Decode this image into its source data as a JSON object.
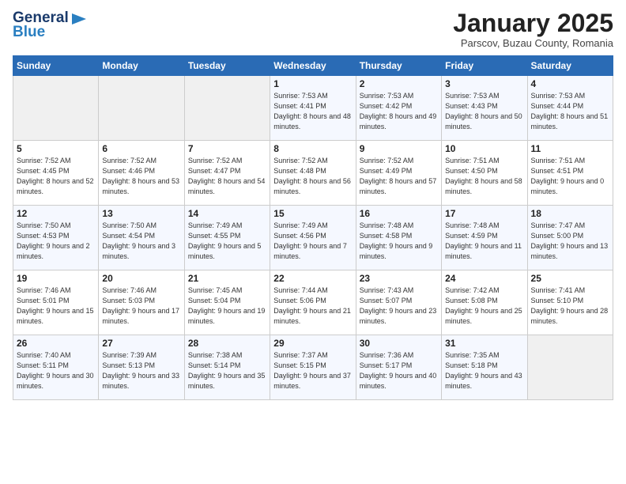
{
  "logo": {
    "line1": "General",
    "line2": "Blue",
    "flag_unicode": "🔵"
  },
  "title": "January 2025",
  "subtitle": "Parscov, Buzau County, Romania",
  "header_days": [
    "Sunday",
    "Monday",
    "Tuesday",
    "Wednesday",
    "Thursday",
    "Friday",
    "Saturday"
  ],
  "weeks": [
    [
      {
        "day": "",
        "sunrise": "",
        "sunset": "",
        "daylight": ""
      },
      {
        "day": "",
        "sunrise": "",
        "sunset": "",
        "daylight": ""
      },
      {
        "day": "",
        "sunrise": "",
        "sunset": "",
        "daylight": ""
      },
      {
        "day": "1",
        "sunrise": "Sunrise: 7:53 AM",
        "sunset": "Sunset: 4:41 PM",
        "daylight": "Daylight: 8 hours and 48 minutes."
      },
      {
        "day": "2",
        "sunrise": "Sunrise: 7:53 AM",
        "sunset": "Sunset: 4:42 PM",
        "daylight": "Daylight: 8 hours and 49 minutes."
      },
      {
        "day": "3",
        "sunrise": "Sunrise: 7:53 AM",
        "sunset": "Sunset: 4:43 PM",
        "daylight": "Daylight: 8 hours and 50 minutes."
      },
      {
        "day": "4",
        "sunrise": "Sunrise: 7:53 AM",
        "sunset": "Sunset: 4:44 PM",
        "daylight": "Daylight: 8 hours and 51 minutes."
      }
    ],
    [
      {
        "day": "5",
        "sunrise": "Sunrise: 7:52 AM",
        "sunset": "Sunset: 4:45 PM",
        "daylight": "Daylight: 8 hours and 52 minutes."
      },
      {
        "day": "6",
        "sunrise": "Sunrise: 7:52 AM",
        "sunset": "Sunset: 4:46 PM",
        "daylight": "Daylight: 8 hours and 53 minutes."
      },
      {
        "day": "7",
        "sunrise": "Sunrise: 7:52 AM",
        "sunset": "Sunset: 4:47 PM",
        "daylight": "Daylight: 8 hours and 54 minutes."
      },
      {
        "day": "8",
        "sunrise": "Sunrise: 7:52 AM",
        "sunset": "Sunset: 4:48 PM",
        "daylight": "Daylight: 8 hours and 56 minutes."
      },
      {
        "day": "9",
        "sunrise": "Sunrise: 7:52 AM",
        "sunset": "Sunset: 4:49 PM",
        "daylight": "Daylight: 8 hours and 57 minutes."
      },
      {
        "day": "10",
        "sunrise": "Sunrise: 7:51 AM",
        "sunset": "Sunset: 4:50 PM",
        "daylight": "Daylight: 8 hours and 58 minutes."
      },
      {
        "day": "11",
        "sunrise": "Sunrise: 7:51 AM",
        "sunset": "Sunset: 4:51 PM",
        "daylight": "Daylight: 9 hours and 0 minutes."
      }
    ],
    [
      {
        "day": "12",
        "sunrise": "Sunrise: 7:50 AM",
        "sunset": "Sunset: 4:53 PM",
        "daylight": "Daylight: 9 hours and 2 minutes."
      },
      {
        "day": "13",
        "sunrise": "Sunrise: 7:50 AM",
        "sunset": "Sunset: 4:54 PM",
        "daylight": "Daylight: 9 hours and 3 minutes."
      },
      {
        "day": "14",
        "sunrise": "Sunrise: 7:49 AM",
        "sunset": "Sunset: 4:55 PM",
        "daylight": "Daylight: 9 hours and 5 minutes."
      },
      {
        "day": "15",
        "sunrise": "Sunrise: 7:49 AM",
        "sunset": "Sunset: 4:56 PM",
        "daylight": "Daylight: 9 hours and 7 minutes."
      },
      {
        "day": "16",
        "sunrise": "Sunrise: 7:48 AM",
        "sunset": "Sunset: 4:58 PM",
        "daylight": "Daylight: 9 hours and 9 minutes."
      },
      {
        "day": "17",
        "sunrise": "Sunrise: 7:48 AM",
        "sunset": "Sunset: 4:59 PM",
        "daylight": "Daylight: 9 hours and 11 minutes."
      },
      {
        "day": "18",
        "sunrise": "Sunrise: 7:47 AM",
        "sunset": "Sunset: 5:00 PM",
        "daylight": "Daylight: 9 hours and 13 minutes."
      }
    ],
    [
      {
        "day": "19",
        "sunrise": "Sunrise: 7:46 AM",
        "sunset": "Sunset: 5:01 PM",
        "daylight": "Daylight: 9 hours and 15 minutes."
      },
      {
        "day": "20",
        "sunrise": "Sunrise: 7:46 AM",
        "sunset": "Sunset: 5:03 PM",
        "daylight": "Daylight: 9 hours and 17 minutes."
      },
      {
        "day": "21",
        "sunrise": "Sunrise: 7:45 AM",
        "sunset": "Sunset: 5:04 PM",
        "daylight": "Daylight: 9 hours and 19 minutes."
      },
      {
        "day": "22",
        "sunrise": "Sunrise: 7:44 AM",
        "sunset": "Sunset: 5:06 PM",
        "daylight": "Daylight: 9 hours and 21 minutes."
      },
      {
        "day": "23",
        "sunrise": "Sunrise: 7:43 AM",
        "sunset": "Sunset: 5:07 PM",
        "daylight": "Daylight: 9 hours and 23 minutes."
      },
      {
        "day": "24",
        "sunrise": "Sunrise: 7:42 AM",
        "sunset": "Sunset: 5:08 PM",
        "daylight": "Daylight: 9 hours and 25 minutes."
      },
      {
        "day": "25",
        "sunrise": "Sunrise: 7:41 AM",
        "sunset": "Sunset: 5:10 PM",
        "daylight": "Daylight: 9 hours and 28 minutes."
      }
    ],
    [
      {
        "day": "26",
        "sunrise": "Sunrise: 7:40 AM",
        "sunset": "Sunset: 5:11 PM",
        "daylight": "Daylight: 9 hours and 30 minutes."
      },
      {
        "day": "27",
        "sunrise": "Sunrise: 7:39 AM",
        "sunset": "Sunset: 5:13 PM",
        "daylight": "Daylight: 9 hours and 33 minutes."
      },
      {
        "day": "28",
        "sunrise": "Sunrise: 7:38 AM",
        "sunset": "Sunset: 5:14 PM",
        "daylight": "Daylight: 9 hours and 35 minutes."
      },
      {
        "day": "29",
        "sunrise": "Sunrise: 7:37 AM",
        "sunset": "Sunset: 5:15 PM",
        "daylight": "Daylight: 9 hours and 37 minutes."
      },
      {
        "day": "30",
        "sunrise": "Sunrise: 7:36 AM",
        "sunset": "Sunset: 5:17 PM",
        "daylight": "Daylight: 9 hours and 40 minutes."
      },
      {
        "day": "31",
        "sunrise": "Sunrise: 7:35 AM",
        "sunset": "Sunset: 5:18 PM",
        "daylight": "Daylight: 9 hours and 43 minutes."
      },
      {
        "day": "",
        "sunrise": "",
        "sunset": "",
        "daylight": ""
      }
    ]
  ]
}
